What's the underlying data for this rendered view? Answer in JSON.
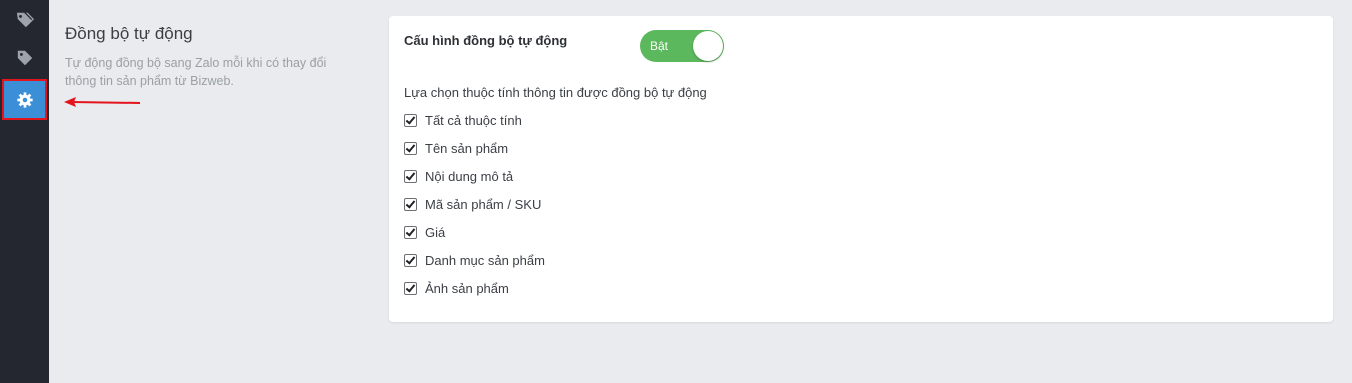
{
  "sidebar": {
    "items": [
      {
        "icon": "tags-icon"
      },
      {
        "icon": "tag-icon"
      },
      {
        "icon": "gear-icon",
        "active": true
      }
    ],
    "active_border_color": "#e3141b",
    "active_bg_color": "#3a8fd6"
  },
  "section": {
    "title": "Đồng bộ tự động",
    "description": "Tự động đồng bộ sang Zalo mỗi khi có thay đổi thông tin sản phẩm từ Bizweb."
  },
  "config": {
    "label": "Cấu hình đồng bộ tự động",
    "toggle_label": "Bật",
    "toggle_on": true,
    "toggle_color": "#5cb85c"
  },
  "attributes": {
    "label": "Lựa chọn thuộc tính thông tin được đồng bộ tự động",
    "options": [
      {
        "label": "Tất cả thuộc tính",
        "checked": true
      },
      {
        "label": "Tên sản phẩm",
        "checked": true
      },
      {
        "label": "Nội dung mô tả",
        "checked": true
      },
      {
        "label": "Mã sản phẩm / SKU",
        "checked": true
      },
      {
        "label": "Giá",
        "checked": true
      },
      {
        "label": "Danh mục sản phẩm",
        "checked": true
      },
      {
        "label": "Ảnh sản phẩm",
        "checked": true
      }
    ]
  }
}
